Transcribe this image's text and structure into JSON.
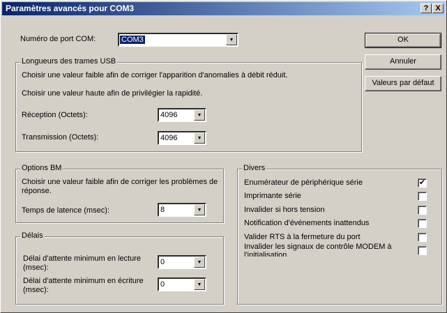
{
  "window": {
    "title": "Paramètres avancés pour COM3",
    "help_label": "?",
    "close_label": "X"
  },
  "port": {
    "label": "Numéro de port COM:",
    "value": "COM3"
  },
  "buttons": {
    "ok": "OK",
    "cancel": "Annuler",
    "defaults": "Valeurs par défaut"
  },
  "usb": {
    "title": "Longueurs des trames USB",
    "hint1": "Choisir une valeur faible afin de corriger  l'apparition d'anomalies à débit réduit.",
    "hint2": "Choisir une valeur haute afin de privilégier la rapidité.",
    "rx_label": "Réception (Octets):",
    "rx_value": "4096",
    "tx_label": "Transmission (Octets):",
    "tx_value": "4096"
  },
  "bm": {
    "title": "Options BM",
    "hint_line1": "Choisir une valeur faible afin de corriger les problèmes de",
    "hint_line2": "réponse.",
    "latency_label": "Temps de latence (msec):",
    "latency_value": "8"
  },
  "delays": {
    "title": "Délais",
    "read_label_line1": "Délai d'attente minimum en lecture",
    "read_label_line2": "(msec):",
    "read_value": "0",
    "write_label_line1": "Délai d'attente minimum en écriture",
    "write_label_line2": "(msec):",
    "write_value": "0"
  },
  "misc": {
    "title": "Divers",
    "items": [
      {
        "label": "Enumérateur de périphérique série",
        "checked": true
      },
      {
        "label": "Imprimante série",
        "checked": false
      },
      {
        "label": "Invalider si hors tension",
        "checked": false
      },
      {
        "label": "Notification d'événements inattendus",
        "checked": false
      },
      {
        "label": "Valider RTS à la fermeture du port",
        "checked": false
      },
      {
        "label_line1": "Invalider les signaux de contrôle MODEM à",
        "label_line2": "l'initialisation",
        "checked": false
      }
    ]
  },
  "icons": {
    "dropdown_arrow": "chevron-down-icon",
    "check_mark": "check-icon"
  }
}
